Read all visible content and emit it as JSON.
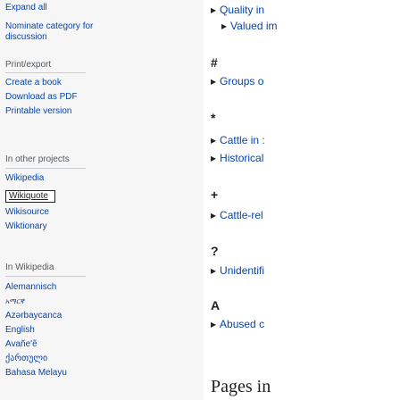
{
  "sidebar": {
    "expand_all": "Expand all",
    "nominate_line1": "Nominate category for",
    "nominate_line2": "discussion",
    "print_export": {
      "heading": "Print/export",
      "items": [
        "Create a book",
        "Download as PDF",
        "Printable version"
      ]
    },
    "other_projects": {
      "heading": "In other projects",
      "items": [
        "Wikipedia",
        "Wikisource",
        "Wiktionary"
      ],
      "wikiquote_logo_text": "Wikiquote"
    },
    "languages": {
      "heading": "In Wikipedia",
      "items": [
        "Alemannisch",
        "አማርኛ",
        "Azərbaycanca",
        "English",
        "Avañe'ẽ",
        "ქართული",
        "Bahasa Melayu"
      ]
    }
  },
  "content": {
    "lines": [
      {
        "type": "item",
        "text": "Quality in"
      },
      {
        "type": "item",
        "text": "Valued im",
        "indent": true
      },
      {
        "type": "heading",
        "text": "#"
      },
      {
        "type": "item",
        "text": "Groups o"
      },
      {
        "type": "heading",
        "text": "*"
      },
      {
        "type": "item",
        "text": "Cattle in :"
      },
      {
        "type": "item",
        "text": "Historical"
      },
      {
        "type": "heading",
        "text": "+"
      },
      {
        "type": "item",
        "text": "Cattle-rel"
      },
      {
        "type": "heading",
        "text": "?"
      },
      {
        "type": "item",
        "text": "Unidentifi"
      },
      {
        "type": "heading",
        "text": "A"
      },
      {
        "type": "item",
        "text": "Abused c"
      }
    ],
    "pages_heading": "Pages in"
  },
  "colors": {
    "link": "#0645ad",
    "text": "#202122",
    "sidebar_bg": "#f6f6f6",
    "content_bg": "#ffffff"
  },
  "icons": {
    "expand_triangle": "triangle-right-icon"
  }
}
